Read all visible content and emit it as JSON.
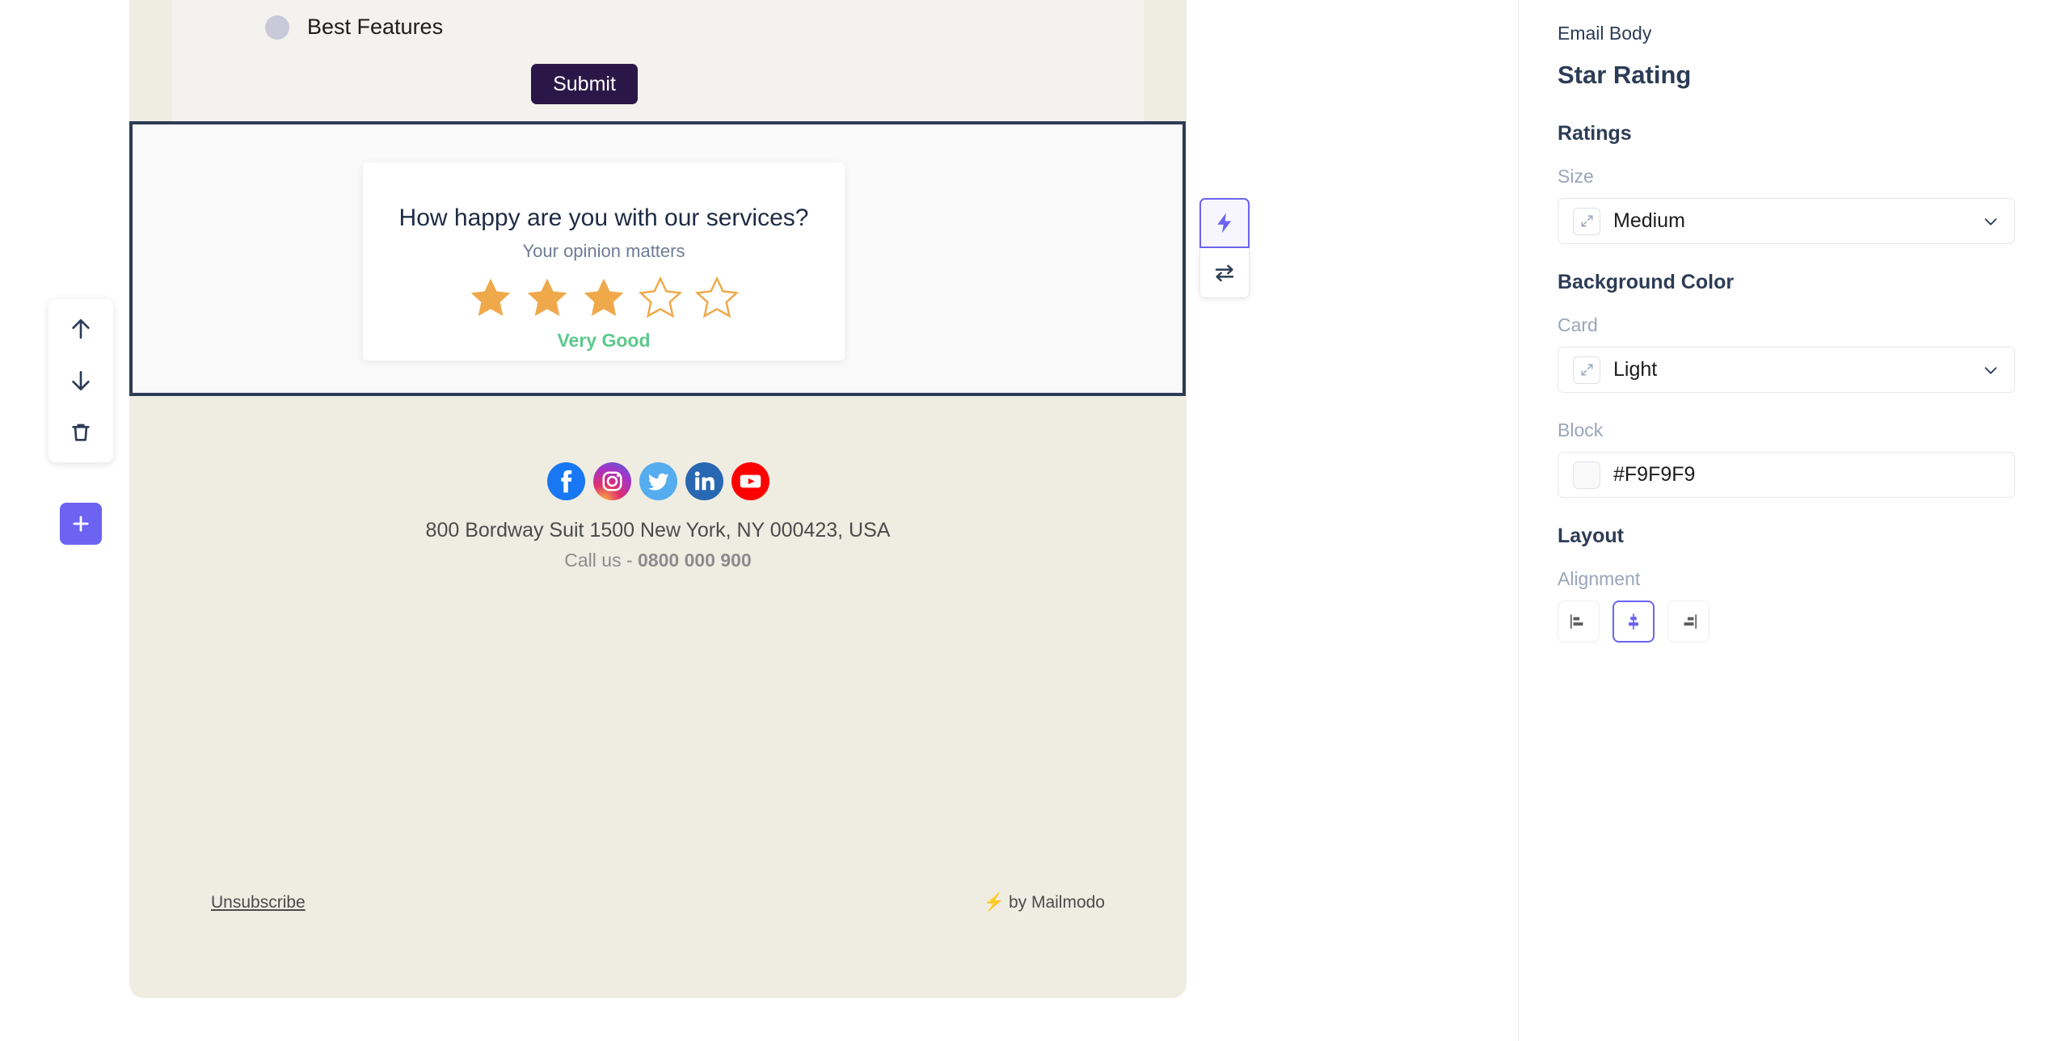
{
  "email": {
    "upper_section": {
      "radio_option_label": "Best Features",
      "submit_label": "Submit"
    },
    "star_rating_block": {
      "title": "How happy are you with our services?",
      "subtitle": "Your opinion matters",
      "verdict": "Very Good",
      "stars_filled": 3,
      "stars_total": 5,
      "star_color": "#F0A94A",
      "verdict_color": "#5CC98C",
      "block_background": "#F9F9F9",
      "card_background": "#FFFFFF"
    },
    "footer": {
      "social_icons": [
        "facebook-icon",
        "instagram-icon",
        "twitter-icon",
        "linkedin-icon",
        "youtube-icon"
      ],
      "address": "800 Bordway Suit 1500 New York, NY 000423, USA",
      "call_prefix": "Call us - ",
      "phone": "0800 000 900"
    },
    "bottom_bar": {
      "unsubscribe": "Unsubscribe",
      "branding": "by Mailmodo",
      "branding_icon": "lightning-bolt-icon"
    }
  },
  "block_toolbar": {
    "move_up_icon": "arrow-up-icon",
    "move_down_icon": "arrow-down-icon",
    "delete_icon": "trash-icon",
    "add_icon": "plus-icon"
  },
  "block_actions": {
    "automation_icon": "lightning-bolt-icon",
    "swap_icon": "swap-arrows-icon",
    "accent": "#6C63F2"
  },
  "panel": {
    "breadcrumb": "Email Body",
    "title": "Star Rating",
    "sections": [
      {
        "heading": "Ratings",
        "fields": [
          {
            "label": "Size",
            "value": "Medium",
            "icon": "expand-icon",
            "type": "select"
          }
        ]
      },
      {
        "heading": "Background Color",
        "fields": [
          {
            "label": "Card",
            "value": "Light",
            "icon": "expand-icon",
            "type": "select"
          },
          {
            "label": "Block",
            "value": "#F9F9F9",
            "icon": "color-swatch",
            "type": "color"
          }
        ]
      },
      {
        "heading": "Layout",
        "fields": [
          {
            "label": "Alignment",
            "type": "align-group",
            "options": [
              "align-left",
              "align-center",
              "align-right"
            ],
            "selected": "align-center"
          }
        ]
      }
    ]
  }
}
